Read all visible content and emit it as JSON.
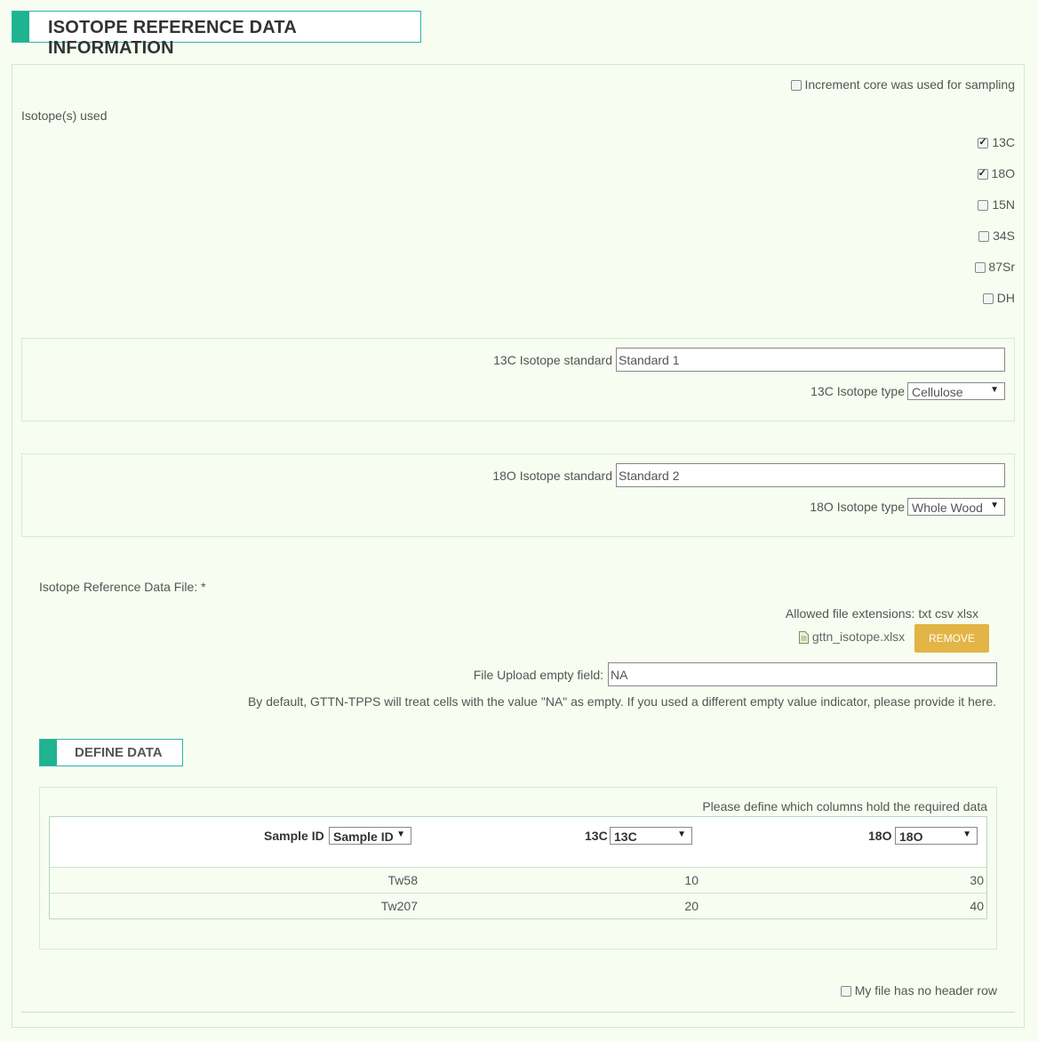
{
  "header": {
    "title": "ISOTOPE REFERENCE DATA INFORMATION"
  },
  "increment_core": {
    "label": "Increment core was used for sampling",
    "checked": false
  },
  "isotopes": {
    "label": "Isotope(s) used",
    "items": [
      {
        "label": "13C",
        "checked": true
      },
      {
        "label": "18O",
        "checked": true
      },
      {
        "label": "15N",
        "checked": false
      },
      {
        "label": "34S",
        "checked": false
      },
      {
        "label": "87Sr",
        "checked": false
      },
      {
        "label": "DH",
        "checked": false
      }
    ]
  },
  "c13": {
    "standard_label": "13C Isotope standard",
    "standard_value": "Standard 1",
    "type_label": "13C Isotope type",
    "type_value": "Cellulose"
  },
  "o18": {
    "standard_label": "18O Isotope standard",
    "standard_value": "Standard 2",
    "type_label": "18O Isotope type",
    "type_value": "Whole Wood"
  },
  "file": {
    "label": "Isotope Reference Data File: *",
    "allowed": "Allowed file extensions: txt csv xlsx",
    "filename": "gttn_isotope.xlsx",
    "remove_label": "REMOVE",
    "empty_label": "File Upload empty field:",
    "empty_value": "NA",
    "help": "By default, GTTN-TPPS will treat cells with the value \"NA\" as empty. If you used a different empty value indicator, please provide it here."
  },
  "define": {
    "title": "DEFINE DATA",
    "hint": "Please define which columns hold the required data",
    "columns": [
      {
        "header": "Sample ID",
        "select": "Sample ID"
      },
      {
        "header": "13C",
        "select": "13C"
      },
      {
        "header": "18O",
        "select": "18O"
      }
    ],
    "rows": [
      [
        "Tw58",
        "10",
        "30"
      ],
      [
        "Tw207",
        "20",
        "40"
      ]
    ]
  },
  "no_header": {
    "label": "My file has no header row",
    "checked": false
  }
}
